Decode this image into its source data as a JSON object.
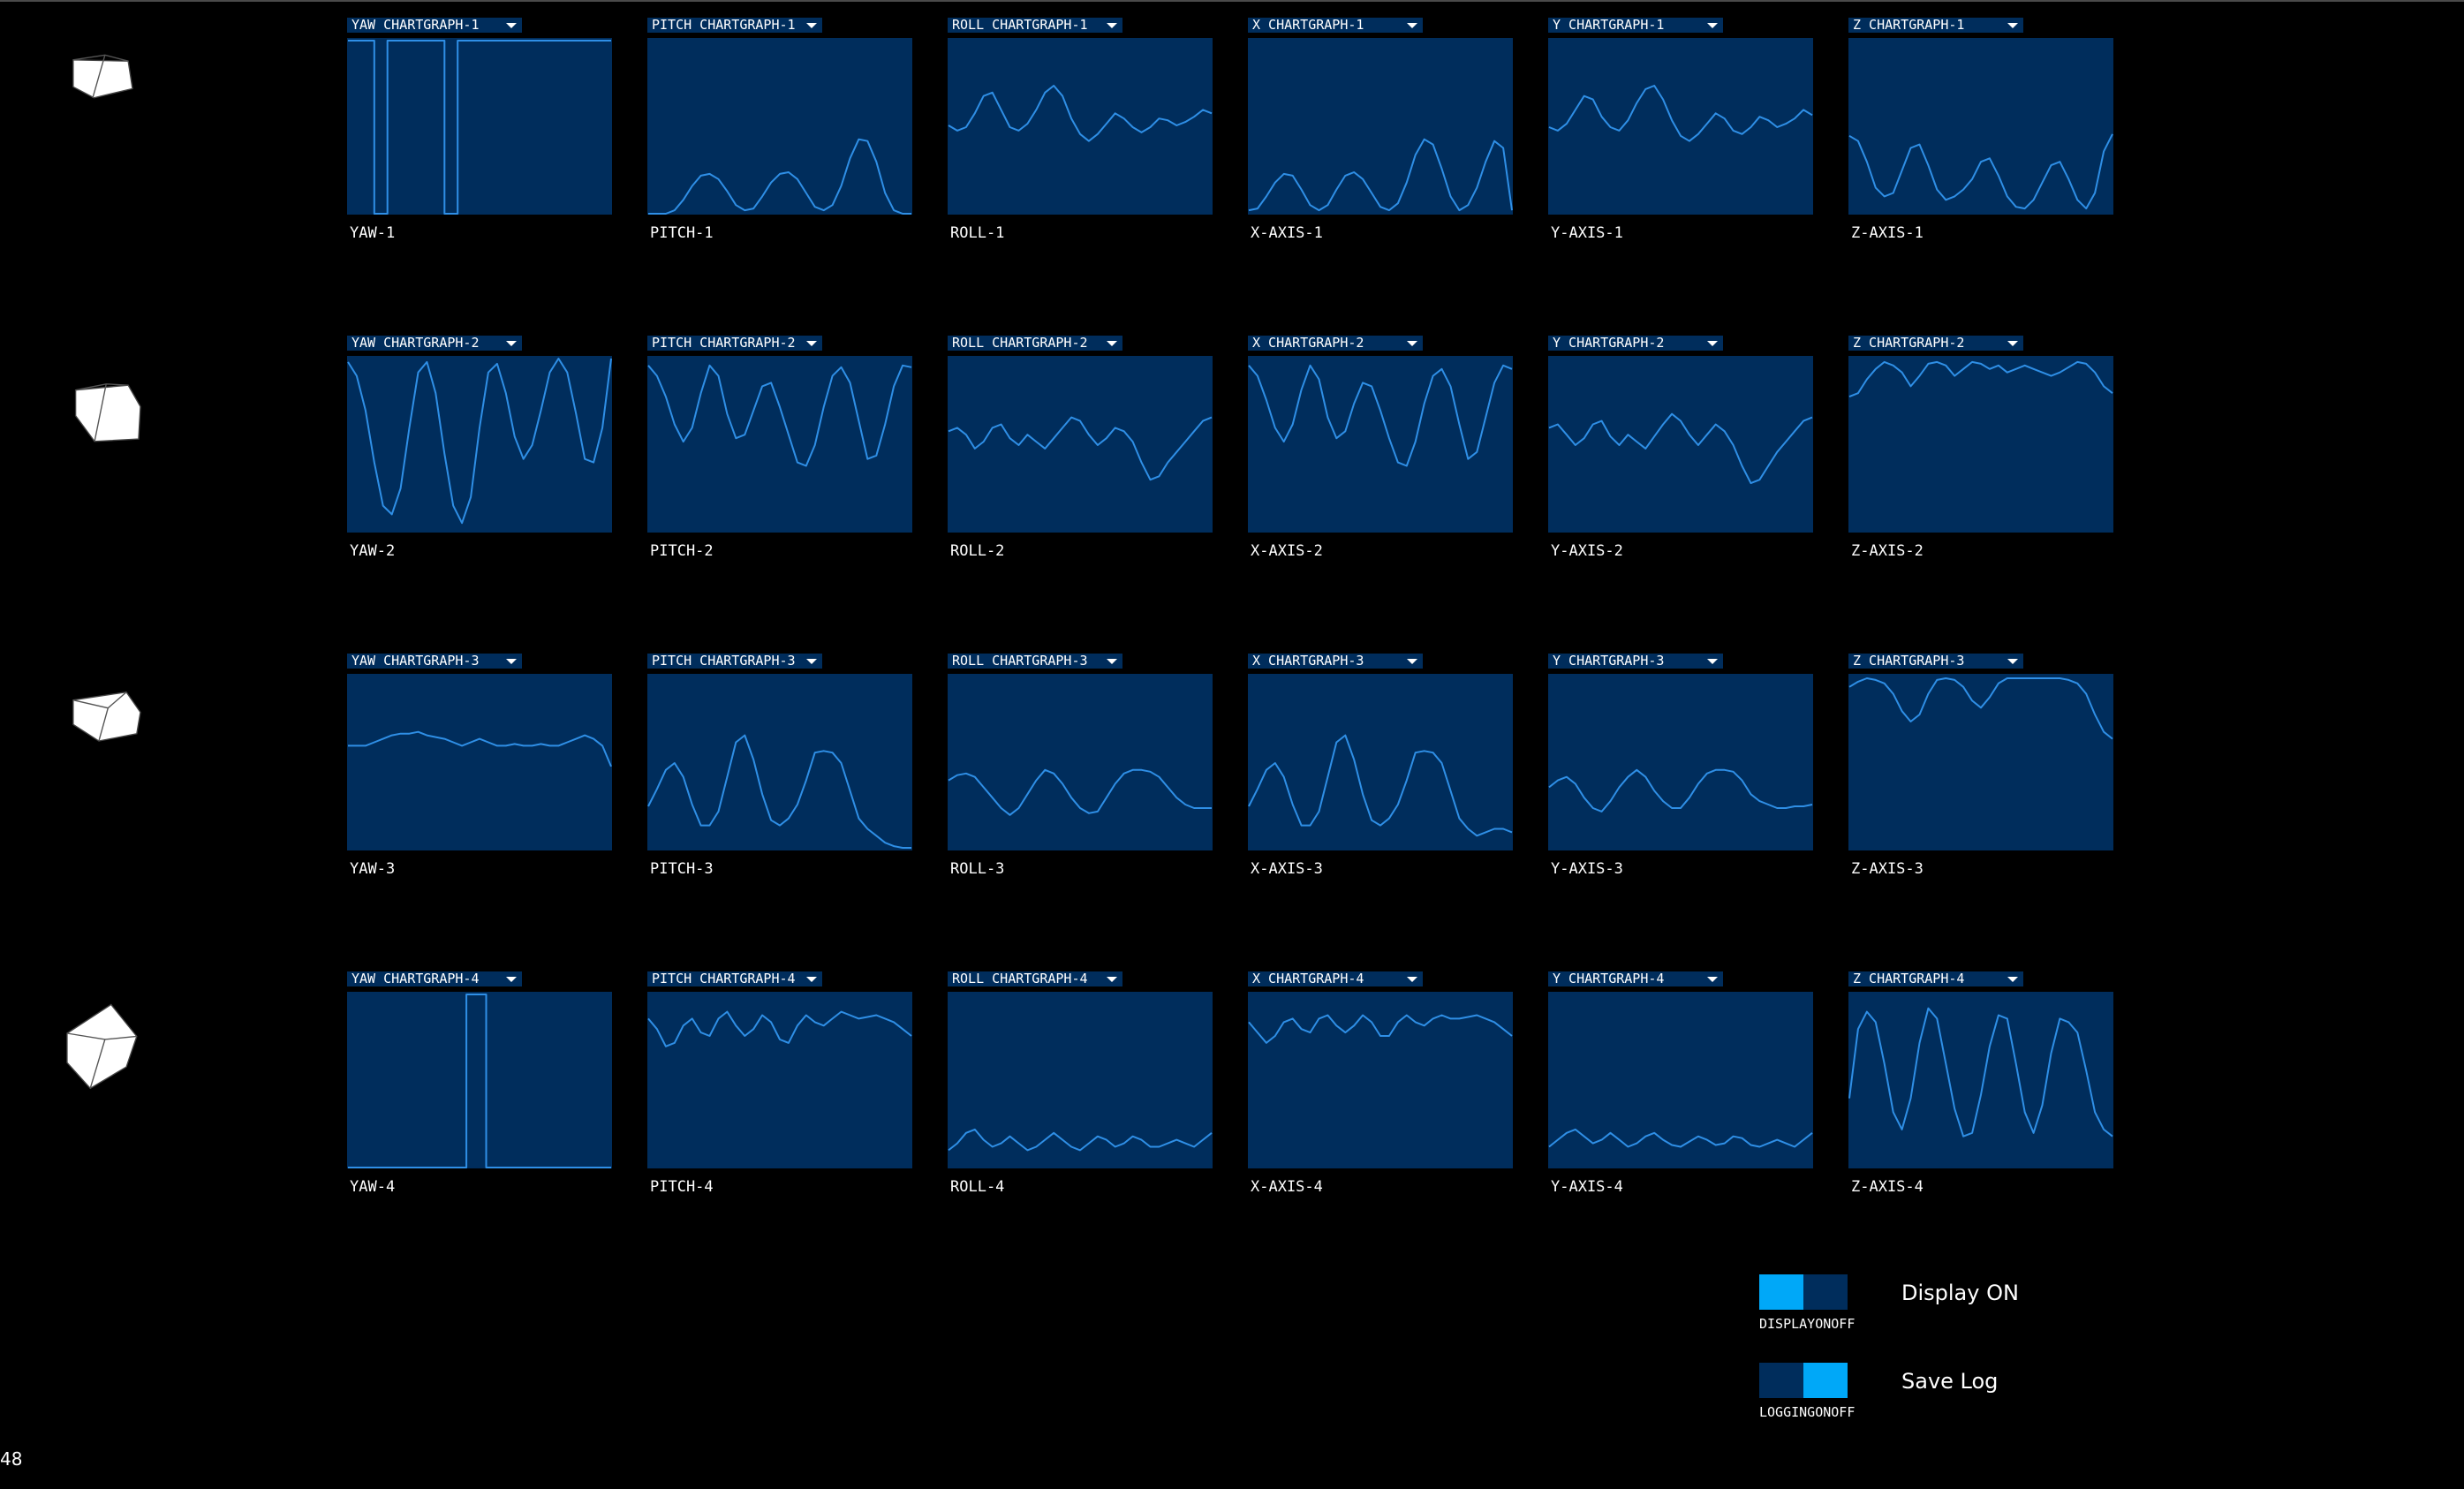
{
  "rows": [
    {
      "cube_icon": "cube-icon",
      "cells": [
        {
          "menu": "YAW CHARTGRAPH-1",
          "label": "YAW-1",
          "series": "YAW-1",
          "values": [
            1,
            1,
            1,
            1,
            1,
            1,
            0,
            0,
            0,
            1,
            1,
            1,
            1,
            1,
            1,
            1,
            1,
            1,
            1,
            1,
            1,
            1,
            0,
            0,
            0,
            1,
            1,
            1,
            1,
            1,
            1,
            1,
            1,
            1,
            1,
            1,
            1,
            1,
            1,
            1,
            1,
            1,
            1,
            1,
            1,
            1,
            1,
            1,
            1,
            1,
            1,
            1,
            1,
            1,
            1,
            1,
            1,
            1,
            1,
            1,
            1
          ]
        },
        {
          "menu": "PITCH CHARTGRAPH-1",
          "label": "PITCH-1",
          "series": "PITCH-1",
          "values": [
            0,
            0,
            0,
            0.02,
            0.08,
            0.16,
            0.22,
            0.23,
            0.2,
            0.13,
            0.05,
            0.02,
            0.03,
            0.1,
            0.18,
            0.23,
            0.24,
            0.2,
            0.12,
            0.04,
            0.02,
            0.05,
            0.16,
            0.32,
            0.43,
            0.42,
            0.3,
            0.12,
            0.02,
            0,
            0
          ]
        },
        {
          "menu": "ROLL CHARTGRAPH-1",
          "label": "ROLL-1",
          "series": "ROLL-1",
          "values": [
            0.51,
            0.48,
            0.5,
            0.58,
            0.68,
            0.7,
            0.6,
            0.5,
            0.48,
            0.52,
            0.6,
            0.7,
            0.74,
            0.68,
            0.55,
            0.46,
            0.42,
            0.46,
            0.52,
            0.58,
            0.55,
            0.5,
            0.47,
            0.5,
            0.55,
            0.54,
            0.51,
            0.53,
            0.56,
            0.6,
            0.58
          ]
        },
        {
          "menu": "X CHARTGRAPH-1",
          "label": "X-AXIS-1",
          "series": "X-AXIS-1",
          "values": [
            0.02,
            0.03,
            0.1,
            0.18,
            0.23,
            0.22,
            0.14,
            0.05,
            0.02,
            0.05,
            0.14,
            0.22,
            0.24,
            0.2,
            0.12,
            0.04,
            0.02,
            0.06,
            0.18,
            0.34,
            0.43,
            0.4,
            0.26,
            0.1,
            0.02,
            0.05,
            0.15,
            0.3,
            0.42,
            0.38,
            0.02
          ]
        },
        {
          "menu": "Y CHARTGRAPH-1",
          "label": "Y-AXIS-1",
          "series": "Y-AXIS-1",
          "values": [
            0.5,
            0.48,
            0.52,
            0.6,
            0.68,
            0.66,
            0.56,
            0.5,
            0.48,
            0.54,
            0.64,
            0.72,
            0.74,
            0.66,
            0.54,
            0.45,
            0.42,
            0.46,
            0.52,
            0.58,
            0.55,
            0.48,
            0.46,
            0.5,
            0.56,
            0.54,
            0.5,
            0.52,
            0.55,
            0.6,
            0.57
          ]
        },
        {
          "menu": "Z CHARTGRAPH-1",
          "label": "Z-AXIS-1",
          "series": "Z-AXIS-1",
          "values": [
            0.45,
            0.42,
            0.3,
            0.15,
            0.1,
            0.12,
            0.25,
            0.38,
            0.4,
            0.28,
            0.14,
            0.08,
            0.1,
            0.14,
            0.2,
            0.3,
            0.32,
            0.22,
            0.1,
            0.04,
            0.03,
            0.08,
            0.18,
            0.28,
            0.3,
            0.2,
            0.08,
            0.03,
            0.12,
            0.36,
            0.46
          ]
        }
      ]
    },
    {
      "cube_icon": "cube-icon",
      "cells": [
        {
          "menu": "YAW CHARTGRAPH-2",
          "label": "YAW-2",
          "series": "YAW-2",
          "values": [
            0.98,
            0.9,
            0.7,
            0.4,
            0.15,
            0.1,
            0.25,
            0.6,
            0.92,
            0.98,
            0.8,
            0.45,
            0.15,
            0.05,
            0.2,
            0.6,
            0.92,
            0.97,
            0.8,
            0.55,
            0.42,
            0.5,
            0.7,
            0.92,
            1,
            0.92,
            0.68,
            0.42,
            0.4,
            0.6,
            1
          ]
        },
        {
          "menu": "PITCH CHARTGRAPH-2",
          "label": "PITCH-2",
          "series": "PITCH-2",
          "values": [
            0.96,
            0.9,
            0.78,
            0.62,
            0.52,
            0.6,
            0.8,
            0.96,
            0.9,
            0.68,
            0.54,
            0.56,
            0.7,
            0.84,
            0.86,
            0.72,
            0.56,
            0.4,
            0.38,
            0.5,
            0.72,
            0.9,
            0.95,
            0.86,
            0.64,
            0.42,
            0.44,
            0.62,
            0.84,
            0.96,
            0.95
          ]
        },
        {
          "menu": "ROLL CHARTGRAPH-2",
          "label": "ROLL-2",
          "series": "ROLL-2",
          "values": [
            0.58,
            0.6,
            0.56,
            0.48,
            0.52,
            0.6,
            0.62,
            0.54,
            0.5,
            0.56,
            0.52,
            0.48,
            0.54,
            0.6,
            0.66,
            0.64,
            0.56,
            0.5,
            0.54,
            0.6,
            0.58,
            0.52,
            0.4,
            0.3,
            0.32,
            0.4,
            0.46,
            0.52,
            0.58,
            0.64,
            0.66
          ]
        },
        {
          "menu": "X CHARTGRAPH-2",
          "label": "X-AXIS-2",
          "series": "X-AXIS-2",
          "values": [
            0.96,
            0.9,
            0.76,
            0.6,
            0.52,
            0.62,
            0.82,
            0.96,
            0.88,
            0.66,
            0.54,
            0.58,
            0.74,
            0.86,
            0.84,
            0.7,
            0.54,
            0.4,
            0.38,
            0.52,
            0.74,
            0.9,
            0.94,
            0.84,
            0.62,
            0.42,
            0.46,
            0.66,
            0.86,
            0.96,
            0.94
          ]
        },
        {
          "menu": "Y CHARTGRAPH-2",
          "label": "Y-AXIS-2",
          "series": "Y-AXIS-2",
          "values": [
            0.6,
            0.62,
            0.56,
            0.5,
            0.54,
            0.62,
            0.64,
            0.55,
            0.5,
            0.56,
            0.52,
            0.48,
            0.55,
            0.62,
            0.68,
            0.64,
            0.56,
            0.5,
            0.56,
            0.62,
            0.58,
            0.5,
            0.38,
            0.28,
            0.3,
            0.38,
            0.46,
            0.52,
            0.58,
            0.64,
            0.66
          ]
        },
        {
          "menu": "Z CHARTGRAPH-2",
          "label": "Z-AXIS-2",
          "series": "Z-AXIS-2",
          "values": [
            0.78,
            0.8,
            0.88,
            0.94,
            0.98,
            0.96,
            0.92,
            0.84,
            0.9,
            0.97,
            0.98,
            0.96,
            0.9,
            0.94,
            0.98,
            0.97,
            0.94,
            0.96,
            0.92,
            0.94,
            0.96,
            0.94,
            0.92,
            0.9,
            0.92,
            0.95,
            0.98,
            0.97,
            0.92,
            0.84,
            0.8
          ]
        }
      ]
    },
    {
      "cube_icon": "cube-icon",
      "cells": [
        {
          "menu": "YAW CHARTGRAPH-3",
          "label": "YAW-3",
          "series": "YAW-3",
          "values": [
            0.6,
            0.6,
            0.6,
            0.62,
            0.64,
            0.66,
            0.67,
            0.67,
            0.68,
            0.66,
            0.65,
            0.64,
            0.62,
            0.6,
            0.62,
            0.64,
            0.62,
            0.6,
            0.6,
            0.61,
            0.6,
            0.6,
            0.61,
            0.6,
            0.6,
            0.62,
            0.64,
            0.66,
            0.64,
            0.6,
            0.48
          ]
        },
        {
          "menu": "PITCH CHARTGRAPH-3",
          "label": "PITCH-3",
          "series": "PITCH-3",
          "values": [
            0.25,
            0.35,
            0.46,
            0.5,
            0.42,
            0.26,
            0.14,
            0.14,
            0.22,
            0.42,
            0.62,
            0.66,
            0.52,
            0.32,
            0.17,
            0.14,
            0.18,
            0.26,
            0.4,
            0.56,
            0.57,
            0.56,
            0.5,
            0.34,
            0.18,
            0.12,
            0.08,
            0.04,
            0.02,
            0.01,
            0.01
          ]
        },
        {
          "menu": "ROLL CHARTGRAPH-3",
          "label": "ROLL-3",
          "series": "ROLL-3",
          "values": [
            0.4,
            0.43,
            0.44,
            0.42,
            0.36,
            0.3,
            0.24,
            0.2,
            0.24,
            0.32,
            0.4,
            0.46,
            0.44,
            0.38,
            0.3,
            0.24,
            0.21,
            0.22,
            0.3,
            0.38,
            0.44,
            0.46,
            0.46,
            0.45,
            0.42,
            0.36,
            0.3,
            0.26,
            0.24,
            0.24,
            0.24
          ]
        },
        {
          "menu": "X CHARTGRAPH-3",
          "label": "X-AXIS-3",
          "series": "X-AXIS-3",
          "values": [
            0.25,
            0.35,
            0.46,
            0.5,
            0.42,
            0.26,
            0.14,
            0.14,
            0.22,
            0.42,
            0.62,
            0.66,
            0.52,
            0.32,
            0.17,
            0.14,
            0.18,
            0.26,
            0.4,
            0.56,
            0.57,
            0.56,
            0.5,
            0.34,
            0.18,
            0.12,
            0.08,
            0.1,
            0.12,
            0.12,
            0.1
          ]
        },
        {
          "menu": "Y CHARTGRAPH-3",
          "label": "Y-AXIS-3",
          "series": "Y-AXIS-3",
          "values": [
            0.36,
            0.4,
            0.42,
            0.38,
            0.3,
            0.24,
            0.22,
            0.28,
            0.36,
            0.42,
            0.46,
            0.42,
            0.34,
            0.28,
            0.24,
            0.24,
            0.3,
            0.38,
            0.44,
            0.46,
            0.46,
            0.45,
            0.4,
            0.32,
            0.28,
            0.26,
            0.24,
            0.24,
            0.25,
            0.25,
            0.26
          ]
        },
        {
          "menu": "Z CHARTGRAPH-3",
          "label": "Z-AXIS-3",
          "series": "Z-AXIS-3",
          "values": [
            0.94,
            0.97,
            0.99,
            0.98,
            0.96,
            0.9,
            0.8,
            0.74,
            0.78,
            0.9,
            0.98,
            0.99,
            0.98,
            0.94,
            0.86,
            0.82,
            0.88,
            0.96,
            0.99,
            0.99,
            0.99,
            0.99,
            0.99,
            0.99,
            0.99,
            0.98,
            0.96,
            0.9,
            0.78,
            0.68,
            0.64
          ]
        }
      ]
    },
    {
      "cube_icon": "cube-icon",
      "cells": [
        {
          "menu": "YAW CHARTGRAPH-4",
          "label": "YAW-4",
          "series": "YAW-4",
          "values": [
            0,
            0,
            0,
            0,
            0,
            0,
            0,
            0,
            0,
            0,
            0,
            0,
            0,
            0,
            0,
            0,
            0,
            0,
            1,
            1,
            1,
            0,
            0,
            0,
            0,
            0,
            0,
            0,
            0,
            0,
            0,
            0,
            0,
            0,
            0,
            0,
            0,
            0,
            0,
            0,
            0
          ]
        },
        {
          "menu": "PITCH CHARTGRAPH-4",
          "label": "PITCH-4",
          "series": "PITCH-4",
          "values": [
            0.86,
            0.8,
            0.7,
            0.72,
            0.82,
            0.86,
            0.78,
            0.76,
            0.86,
            0.9,
            0.82,
            0.76,
            0.8,
            0.88,
            0.84,
            0.74,
            0.72,
            0.82,
            0.88,
            0.84,
            0.82,
            0.86,
            0.9,
            0.88,
            0.86,
            0.87,
            0.88,
            0.86,
            0.84,
            0.8,
            0.76
          ]
        },
        {
          "menu": "ROLL CHARTGRAPH-4",
          "label": "ROLL-4",
          "series": "ROLL-4",
          "values": [
            0.1,
            0.14,
            0.2,
            0.22,
            0.16,
            0.12,
            0.14,
            0.18,
            0.14,
            0.1,
            0.12,
            0.16,
            0.2,
            0.16,
            0.12,
            0.1,
            0.14,
            0.18,
            0.16,
            0.12,
            0.14,
            0.18,
            0.16,
            0.12,
            0.12,
            0.14,
            0.16,
            0.14,
            0.12,
            0.16,
            0.2
          ]
        },
        {
          "menu": "X CHARTGRAPH-4",
          "label": "X-AXIS-4",
          "series": "X-AXIS-4",
          "values": [
            0.84,
            0.78,
            0.72,
            0.76,
            0.84,
            0.86,
            0.8,
            0.78,
            0.86,
            0.88,
            0.82,
            0.78,
            0.82,
            0.88,
            0.84,
            0.76,
            0.76,
            0.84,
            0.88,
            0.84,
            0.82,
            0.86,
            0.88,
            0.86,
            0.86,
            0.87,
            0.88,
            0.86,
            0.84,
            0.8,
            0.76
          ]
        },
        {
          "menu": "Y CHARTGRAPH-4",
          "label": "Y-AXIS-4",
          "series": "Y-AXIS-4",
          "values": [
            0.12,
            0.16,
            0.2,
            0.22,
            0.18,
            0.14,
            0.16,
            0.2,
            0.16,
            0.12,
            0.14,
            0.18,
            0.2,
            0.16,
            0.13,
            0.12,
            0.15,
            0.18,
            0.16,
            0.13,
            0.14,
            0.18,
            0.17,
            0.13,
            0.12,
            0.14,
            0.16,
            0.14,
            0.12,
            0.16,
            0.2
          ]
        },
        {
          "menu": "Z CHARTGRAPH-4",
          "label": "Z-AXIS-4",
          "series": "Z-AXIS-4",
          "values": [
            0.4,
            0.8,
            0.9,
            0.84,
            0.6,
            0.32,
            0.22,
            0.4,
            0.72,
            0.92,
            0.86,
            0.6,
            0.34,
            0.18,
            0.2,
            0.42,
            0.7,
            0.88,
            0.86,
            0.6,
            0.32,
            0.2,
            0.36,
            0.66,
            0.86,
            0.84,
            0.78,
            0.56,
            0.32,
            0.22,
            0.18
          ]
        }
      ]
    }
  ],
  "controls": {
    "display": {
      "caption": "DISPLAYONOFF",
      "label": "Display ON",
      "state": "on-left"
    },
    "logging": {
      "caption": "LOGGINGONOFF",
      "label": "Save Log",
      "state": "on-right"
    }
  },
  "fps": "48",
  "colors": {
    "background": "#000000",
    "panel": "#002d5c",
    "line": "#2f8fe6",
    "toggle_on": "#00a8f8",
    "toggle_off": "#002d5c"
  }
}
